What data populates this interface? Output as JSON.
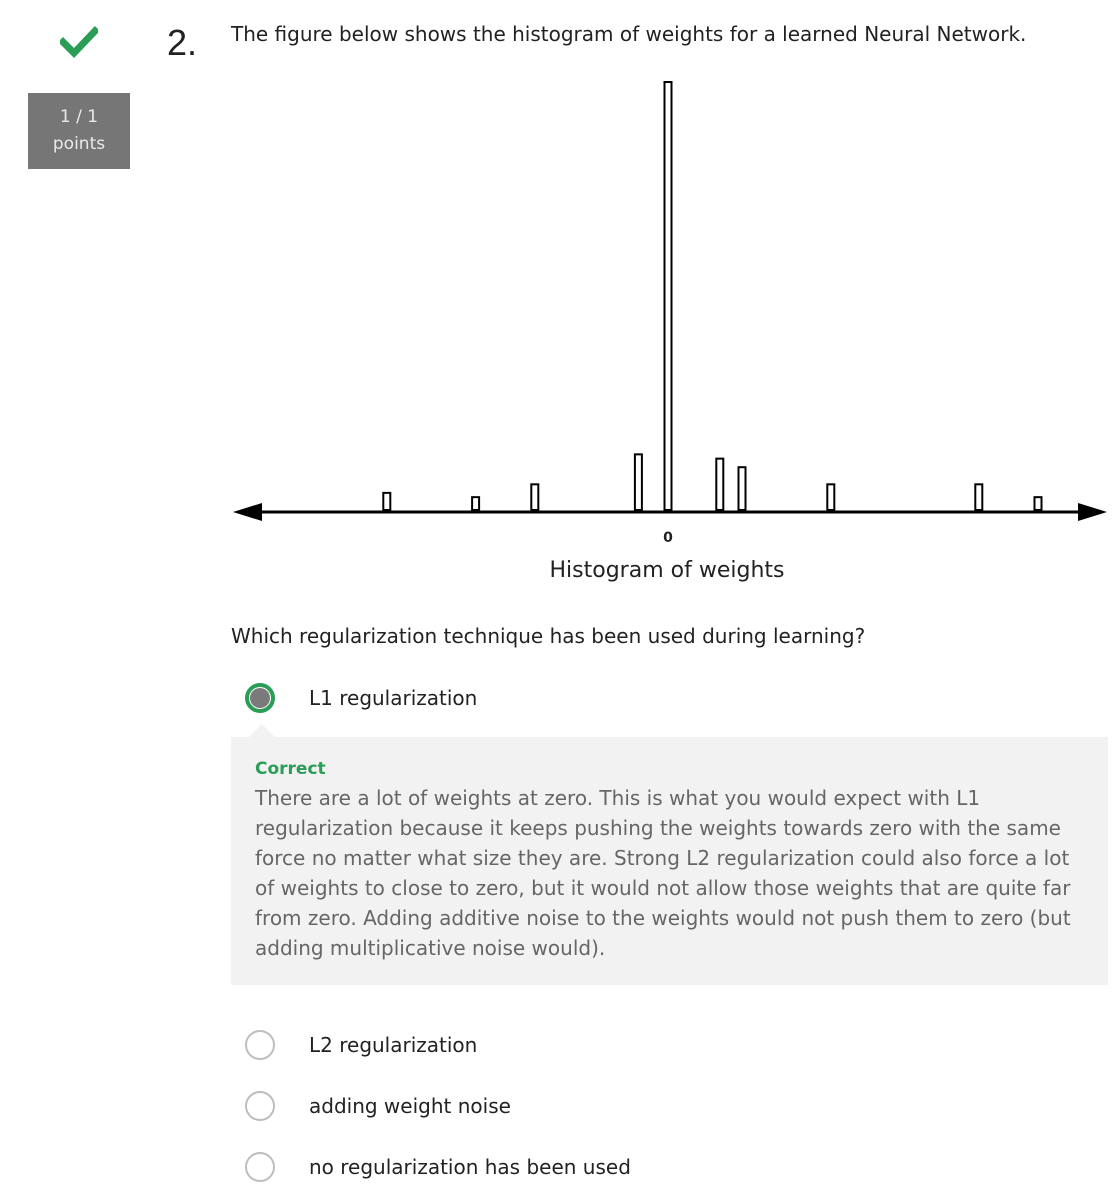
{
  "status": {
    "icon": "check-icon",
    "icon_color": "#2a9d57"
  },
  "score": {
    "value": "1 / 1",
    "unit": "points"
  },
  "question": {
    "number": "2.",
    "text": "The figure below shows the histogram of weights for a learned Neural Network.",
    "prompt": "Which regularization technique has been used during learning?"
  },
  "chart_data": {
    "type": "bar",
    "title": "",
    "xlabel": "Histogram of weights",
    "zero_tick": "0",
    "bars": [
      {
        "x": -9.5,
        "h": 0.04
      },
      {
        "x": -6.5,
        "h": 0.03
      },
      {
        "x": -4.5,
        "h": 0.06
      },
      {
        "x": -1,
        "h": 0.13
      },
      {
        "x": 0,
        "h": 1.0
      },
      {
        "x": 1.75,
        "h": 0.12
      },
      {
        "x": 2.5,
        "h": 0.1
      },
      {
        "x": 5.5,
        "h": 0.06
      },
      {
        "x": 10.5,
        "h": 0.06
      },
      {
        "x": 12.5,
        "h": 0.03
      }
    ]
  },
  "options": [
    {
      "label": "L1 regularization",
      "selected": true
    },
    {
      "label": "L2 regularization",
      "selected": false
    },
    {
      "label": "adding weight noise",
      "selected": false
    },
    {
      "label": "no regularization has been used",
      "selected": false
    }
  ],
  "feedback": {
    "title": "Correct",
    "body": "There are a lot of weights at zero. This is what you would expect with L1 regularization because it keeps pushing the weights towards zero with the same force no matter what size they are. Strong L2 regularization could also force a lot of weights to close to zero, but it would not allow those weights that are quite far from zero. Adding additive noise to the weights would not push them to zero (but adding multiplicative noise would).",
    "title_color": "#2a9d57"
  }
}
